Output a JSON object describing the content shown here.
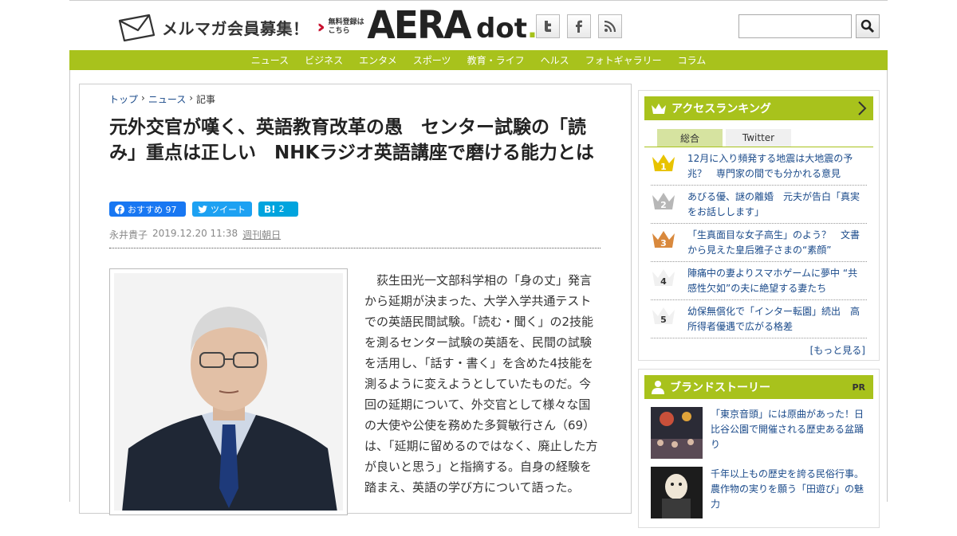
{
  "header": {
    "mailmag_label": "メルマガ会員募集！",
    "mailmag_sub1": "無料登録は",
    "mailmag_sub2": "こちら",
    "logo_main": "AERA",
    "logo_sub": "dot",
    "logo_dot": ".",
    "search_placeholder": ""
  },
  "nav": [
    "ニュース",
    "ビジネス",
    "エンタメ",
    "スポーツ",
    "教育・ライフ",
    "ヘルス",
    "フォトギャラリー",
    "コラム"
  ],
  "breadcrumb": {
    "home": "トップ",
    "section": "ニュース",
    "current": "記事"
  },
  "article": {
    "title": "元外交官が嘆く、英語教育改革の愚　センター試験の「読み」重点は正しい　NHKラジオ英語講座で磨ける能力とは",
    "fb_label": "おすすめ 97",
    "tw_label": "ツイート",
    "hb_label": "2",
    "author": "永井貴子",
    "date": "2019.12.20 11:38",
    "magazine": "週刊朝日",
    "body": "　荻生田光一文部科学相の「身の丈」発言から延期が決まった、大学入学共通テストでの英語民間試験。「読む・聞く」の2技能を測るセンター試験の英語を、民間の試験を活用し、「話す・書く」を含めた4技能を測るように変えようとしていたものだ。今回の延期について、外交官として様々な国の大使や公使を務めた多賀敏行さん（69）は、「延期に留めるのではなく、廃止した方が良いと思う」と指摘する。自身の経験を踏まえ、英語の学び方について語った。"
  },
  "ranking": {
    "title": "アクセスランキング",
    "tabs": [
      "総合",
      "Twitter"
    ],
    "items": [
      {
        "rank": "1",
        "text": "12月に入り頻発する地震は大地震の予兆？　専門家の間でも分かれる意見"
      },
      {
        "rank": "2",
        "text": "あびる優、謎の離婚　元夫が告白「真実をお話しします」"
      },
      {
        "rank": "3",
        "text": "「生真面目な女子高生」のよう？　文書から見えた皇后雅子さまの“素顔”"
      },
      {
        "rank": "4",
        "text": "陣痛中の妻よりスマホゲームに夢中 “共感性欠如”の夫に絶望する妻たち"
      },
      {
        "rank": "5",
        "text": "幼保無償化で「インター転園」続出　高所得者優遇で広がる格差"
      }
    ],
    "more": "[もっと見る]"
  },
  "brand": {
    "title": "ブランドストーリー",
    "pr": "PR",
    "items": [
      {
        "text": "「東京音頭」には原曲があった！日比谷公園で開催される歴史ある盆踊り"
      },
      {
        "text": "千年以上もの歴史を誇る民俗行事。農作物の実りを願う「田遊び」の魅力"
      }
    ]
  },
  "colors": {
    "accent": "#a8c21c",
    "link": "#1a4a8a",
    "facebook": "#1877f2",
    "twitter": "#1da1f2",
    "hatena": "#00a4de",
    "gold": "#e8c300",
    "silver": "#b7b7b7",
    "bronze": "#d9893d"
  }
}
